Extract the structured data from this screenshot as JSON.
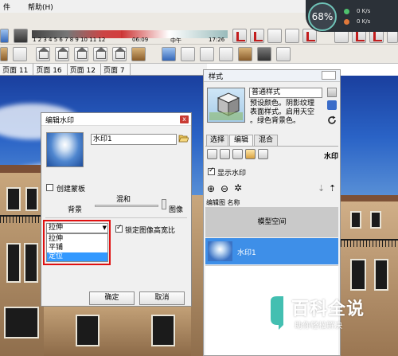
{
  "menu": {
    "item_file": "件",
    "item_help": "帮助(H)"
  },
  "toolbar": {
    "shadow_months": "1 2 3 4 5 6 7 8 9 10 11 12",
    "shadow_time_start": "06:09",
    "shadow_noon": "中午",
    "shadow_time_end": "17:26"
  },
  "scene_tabs": [
    "页面 11",
    "页面 16",
    "页面 12",
    "页面 7"
  ],
  "speed_widget": {
    "percent": "68%",
    "upload": "0 K/s",
    "download": "0 K/s"
  },
  "watermark_dialog": {
    "title": "编辑水印",
    "close_label": "x",
    "name_value": "水印1",
    "create_mask_label": "创建蒙板",
    "blend_label": "混和",
    "background_label": "背景",
    "image_label": "图像",
    "select_value": "拉伸",
    "dropdown_options": [
      "拉伸",
      "平铺",
      "定位"
    ],
    "selected_option_index": 2,
    "lock_aspect_label": "锁定图像高宽比",
    "ok_label": "确定",
    "cancel_label": "取消"
  },
  "styles_panel": {
    "title": "样式",
    "style_name": "普通样式",
    "description_lines": [
      "预设颜色。阴影纹理",
      "表面样式。启用天空",
      "。绿色背景色。"
    ],
    "tabs": [
      "选择",
      "编辑",
      "混合"
    ],
    "active_tab_index": 1,
    "section_title": "水印",
    "show_watermark_label": "显示水印",
    "list_header": "编辑图 名称",
    "model_space_label": "模型空间",
    "watermark_row_label": "水印1"
  },
  "baike_logo": {
    "title": "百科全说",
    "subtitle": "助你轻松解决"
  },
  "colors": {
    "accent_blue": "#3e8fe8",
    "select_highlight": "#3399ff",
    "annotation_red": "#e01010",
    "close_red": "#c93a32"
  }
}
